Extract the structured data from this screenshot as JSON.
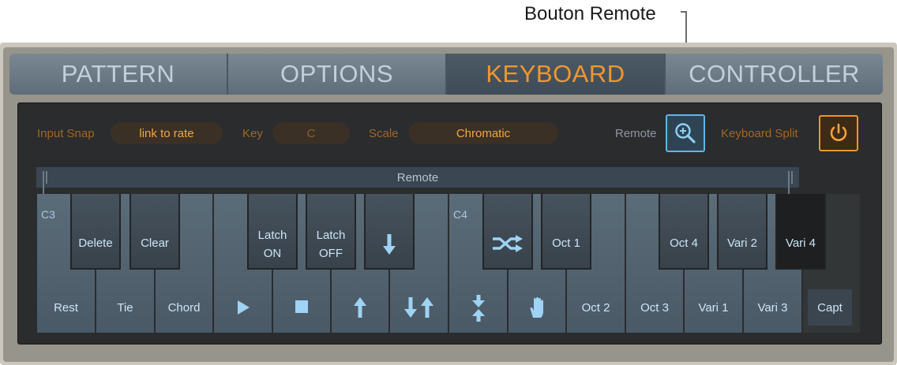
{
  "callout": {
    "label": "Bouton Remote"
  },
  "tabs": [
    {
      "label": "PATTERN",
      "active": false
    },
    {
      "label": "OPTIONS",
      "active": false
    },
    {
      "label": "KEYBOARD",
      "active": true
    },
    {
      "label": "CONTROLLER",
      "active": false
    }
  ],
  "controls": {
    "input_snap_label": "Input Snap",
    "input_snap_value": "link to rate",
    "key_label": "Key",
    "key_value": "C",
    "scale_label": "Scale",
    "scale_value": "Chromatic",
    "remote_label": "Remote",
    "keyboard_split_label": "Keyboard Split"
  },
  "strip": {
    "label": "Remote"
  },
  "octave_labels": {
    "c3": "C3",
    "c4": "C4"
  },
  "white_keys": [
    {
      "label": "Rest",
      "icon": ""
    },
    {
      "label": "Tie",
      "icon": ""
    },
    {
      "label": "Chord",
      "icon": ""
    },
    {
      "label": "",
      "icon": "play-icon"
    },
    {
      "label": "",
      "icon": "stop-icon"
    },
    {
      "label": "",
      "icon": "arrow-up-icon"
    },
    {
      "label": "",
      "icon": "arrows-down-up-icon"
    },
    {
      "label": "",
      "icon": "arrows-converge-icon"
    },
    {
      "label": "",
      "icon": "hand-icon"
    },
    {
      "label": "Oct 2",
      "icon": ""
    },
    {
      "label": "Oct 3",
      "icon": ""
    },
    {
      "label": "Vari 1",
      "icon": ""
    },
    {
      "label": "Vari 3",
      "icon": ""
    }
  ],
  "black_keys": [
    {
      "label": "Delete",
      "icon": ""
    },
    {
      "label": "Clear",
      "icon": ""
    },
    {
      "label": "Latch",
      "label2": "ON",
      "icon": ""
    },
    {
      "label": "Latch",
      "label2": "OFF",
      "icon": ""
    },
    {
      "label": "",
      "icon": "arrow-down-icon"
    },
    {
      "label": "",
      "icon": "shuffle-icon"
    },
    {
      "label": "Oct 1",
      "icon": ""
    },
    {
      "label": "Oct 4",
      "icon": ""
    },
    {
      "label": "Vari 2",
      "icon": ""
    },
    {
      "label": "Vari 4",
      "icon": ""
    }
  ],
  "capt": {
    "label": "Capt"
  },
  "colors": {
    "accent_orange": "#f3962e",
    "accent_blue": "#5fb6e8"
  }
}
